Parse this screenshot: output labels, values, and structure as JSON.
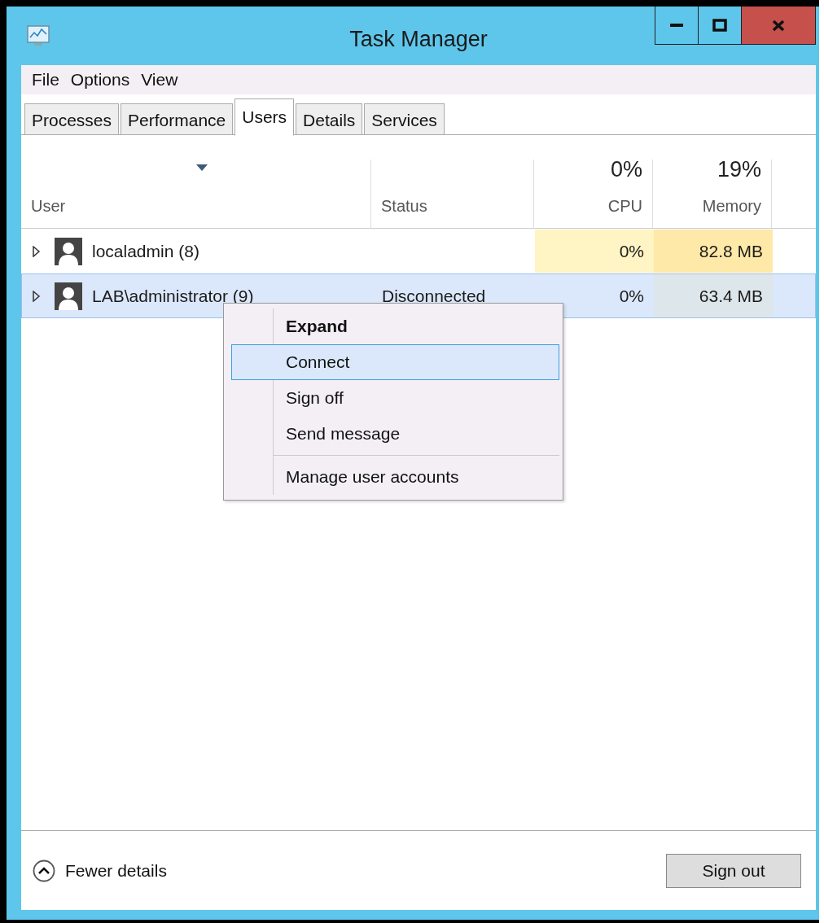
{
  "window": {
    "title": "Task Manager",
    "controls": [
      {
        "kind": "minimize"
      },
      {
        "kind": "maximize"
      },
      {
        "kind": "close"
      }
    ]
  },
  "menu_bar": [
    "File",
    "Options",
    "View"
  ],
  "tabs": [
    {
      "label": "Processes",
      "selected": false
    },
    {
      "label": "Performance",
      "selected": false
    },
    {
      "label": "Users",
      "selected": true
    },
    {
      "label": "Details",
      "selected": false
    },
    {
      "label": "Services",
      "selected": false
    }
  ],
  "table": {
    "columns": [
      {
        "label": "User",
        "sorted": true
      },
      {
        "label": "Status"
      },
      {
        "label": "CPU",
        "summary": "0%"
      },
      {
        "label": "Memory",
        "summary": "19%"
      }
    ],
    "rows": [
      {
        "user": "localadmin (8)",
        "expanded": false,
        "selected": false,
        "cpu": "0%",
        "memory": "82.8 MB"
      },
      {
        "user": "LAB\\administrator (9)",
        "status": "Disconnected",
        "expanded": false,
        "selected": true,
        "cpu": "0%",
        "memory": "63.4 MB"
      }
    ]
  },
  "context_menu": [
    {
      "kind": "item",
      "label": "Expand",
      "default": true,
      "selected": false
    },
    {
      "kind": "item",
      "label": "Connect",
      "default": false,
      "selected": true
    },
    {
      "kind": "item",
      "label": "Sign off",
      "default": false,
      "selected": false
    },
    {
      "kind": "item",
      "label": "Send message",
      "default": false,
      "selected": false
    },
    {
      "kind": "separator"
    },
    {
      "kind": "item",
      "label": "Manage user accounts",
      "default": false,
      "selected": false
    }
  ],
  "footer": {
    "toggle": "Fewer details",
    "button": "Sign out"
  }
}
